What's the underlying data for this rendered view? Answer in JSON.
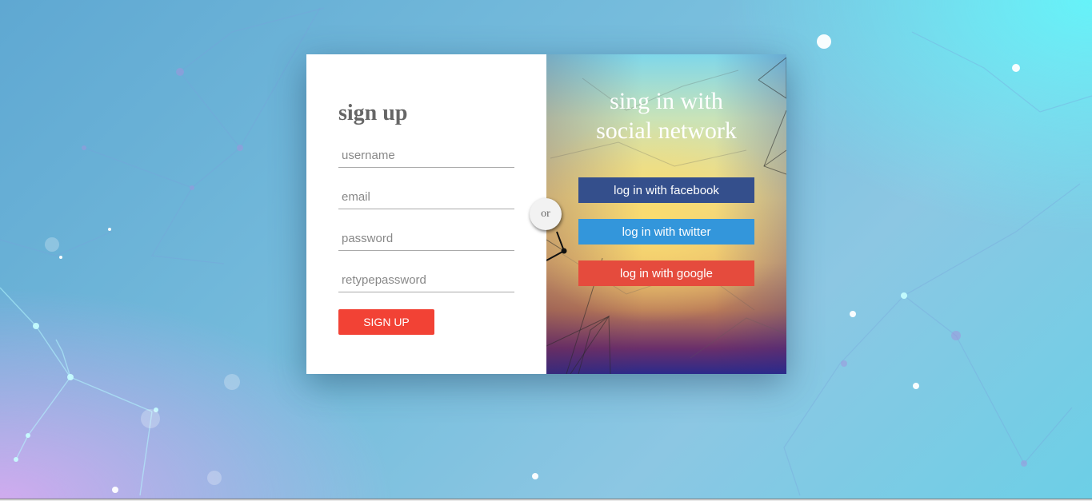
{
  "signup": {
    "title": "sign up",
    "username_placeholder": "username",
    "email_placeholder": "email",
    "password_placeholder": "password",
    "retype_placeholder": "retypepassword",
    "button_label": "SIGN UP"
  },
  "divider": {
    "label": "or"
  },
  "social": {
    "title_line1": "sing in with",
    "title_line2": "social network",
    "facebook_label": "log in with facebook",
    "twitter_label": "log in with twitter",
    "google_label": "log in with google"
  },
  "colors": {
    "facebook": "#344f8c",
    "twitter": "#3396db",
    "google": "#e54b3d",
    "signup_button": "#f24235"
  }
}
